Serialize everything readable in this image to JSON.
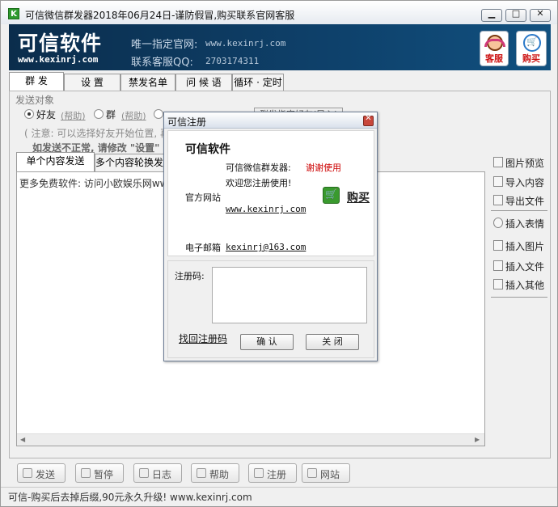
{
  "window": {
    "icon_letter": "K",
    "title": "可信微信群发器2018年06月24日-谨防假冒,购买联系官网客服",
    "min_glyph": "▁",
    "max_glyph": "□",
    "close_glyph": "✕"
  },
  "banner": {
    "brand": "可信软件",
    "url": "www.kexinrj.com",
    "site_label": "唯一指定官网:",
    "site_value": "www.kexinrj.com",
    "qq_label": "联系客服QQ:",
    "qq_value": "2703174311",
    "kefu_label": "客服",
    "buy_label": "购买",
    "cart_glyph": "🛒"
  },
  "tabs": [
    "群 发",
    "设 置",
    "禁发名单",
    "问 候 语",
    "循环 · 定时"
  ],
  "send_target": {
    "label": "发送对象",
    "opt_friend": "好友",
    "opt_group": "群",
    "opt_custom": "群发指定好友",
    "help": "(帮助)",
    "ghost_button": "群发指定好友(导入)",
    "notice": "( 注意: 可以选择好友开始位置, 再",
    "warn": "如发送不正常, 请修改 \"设置\""
  },
  "subtabs": [
    "单个内容发送",
    "多个内容轮换发送"
  ],
  "editor_text": "更多免费软件: 访问小欧娱乐网www.x",
  "side": [
    "图片预览",
    "导入内容",
    "导出文件",
    "插入表情",
    "插入图片",
    "插入文件",
    "插入其他"
  ],
  "bottom_buttons": [
    "发送",
    "暂停",
    "日志",
    "帮助",
    "注册",
    "网站"
  ],
  "status": "可信-购买后去掉后缀,90元永久升级! www.kexinrj.com",
  "dialog": {
    "title": "可信注册",
    "brand": "可信软件",
    "product_label": "可信微信群发器:",
    "thanks": "谢谢使用",
    "welcome": "欢迎您注册使用!",
    "site_label": "官方网站",
    "site_link": "www.kexinrj.com",
    "buy": "购买",
    "email_label": "电子邮箱",
    "email": "kexinrj@163.com",
    "reg_label": "注册码:",
    "find_code": "找回注册码",
    "ok": "确 认",
    "close": "关 闭"
  }
}
